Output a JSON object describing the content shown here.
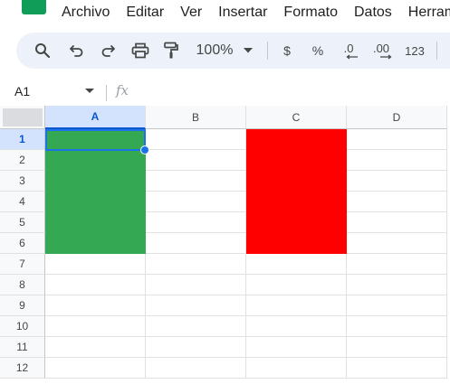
{
  "app": {
    "name": "Google Sheets",
    "logo_color": "#0f9d58"
  },
  "menu": [
    {
      "label": "Archivo"
    },
    {
      "label": "Editar"
    },
    {
      "label": "Ver"
    },
    {
      "label": "Insertar"
    },
    {
      "label": "Formato"
    },
    {
      "label": "Datos"
    },
    {
      "label": "Herramientas"
    }
  ],
  "toolbar": {
    "icons": [
      "search-icon",
      "undo-icon",
      "redo-icon",
      "print-icon",
      "paint-format-icon"
    ],
    "zoom": "100%",
    "currency": "$",
    "percent": "%",
    "decrease_decimal": ".0",
    "increase_decimal": ".00",
    "number_format": "123"
  },
  "formula_bar": {
    "cell_ref": "A1",
    "fx": "fx",
    "value": ""
  },
  "grid": {
    "columns": [
      "A",
      "B",
      "C",
      "D"
    ],
    "rows": [
      "1",
      "2",
      "3",
      "4",
      "5",
      "6",
      "7",
      "8",
      "9",
      "10",
      "11",
      "12"
    ],
    "selected_cell": "A1",
    "filled_ranges": [
      {
        "range": "A1:A6",
        "color": "#34a853"
      },
      {
        "range": "C1:C6",
        "color": "#ff0000"
      }
    ],
    "selection_color": "#1a73e8"
  }
}
